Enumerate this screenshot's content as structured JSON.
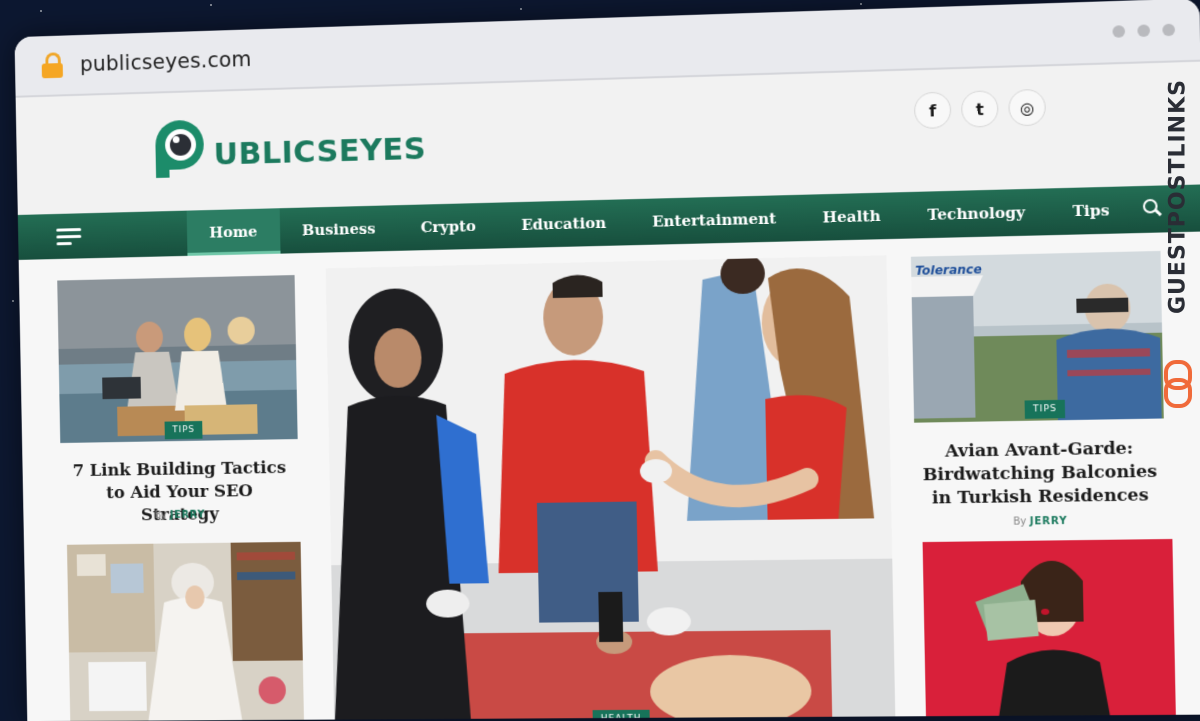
{
  "browser": {
    "url": "publicseyes.com"
  },
  "site": {
    "logo_text": "UBLICSEYES",
    "social": [
      {
        "icon": "facebook-icon",
        "glyph": "f"
      },
      {
        "icon": "twitter-icon",
        "glyph": "t"
      },
      {
        "icon": "instagram-icon",
        "glyph": "◎"
      }
    ],
    "nav": {
      "items": [
        {
          "label": "Home",
          "active": true
        },
        {
          "label": "Business"
        },
        {
          "label": "Crypto"
        },
        {
          "label": "Education"
        },
        {
          "label": "Entertainment"
        },
        {
          "label": "Health"
        },
        {
          "label": "Technology"
        },
        {
          "label": "Tips"
        }
      ]
    }
  },
  "articles": {
    "left_top": {
      "tag": "TIPS",
      "title": "7 Link Building Tactics to Aid Your SEO Strategy",
      "by": "By",
      "author": "JERRY"
    },
    "featured": {
      "tag": "HEALTH"
    },
    "right_top": {
      "tag": "TIPS",
      "title": "Avian Avant-Garde: Birdwatching Balconies in Turkish Residences",
      "by": "By",
      "author": "JERRY",
      "image_sign": "Tolerance"
    }
  },
  "watermark": {
    "text": "GUESTPOSTLINKS"
  },
  "colors": {
    "brand_green": "#1c7a5e",
    "nav_green": "#1e5f49",
    "watermark_orange": "#f06a3a"
  }
}
